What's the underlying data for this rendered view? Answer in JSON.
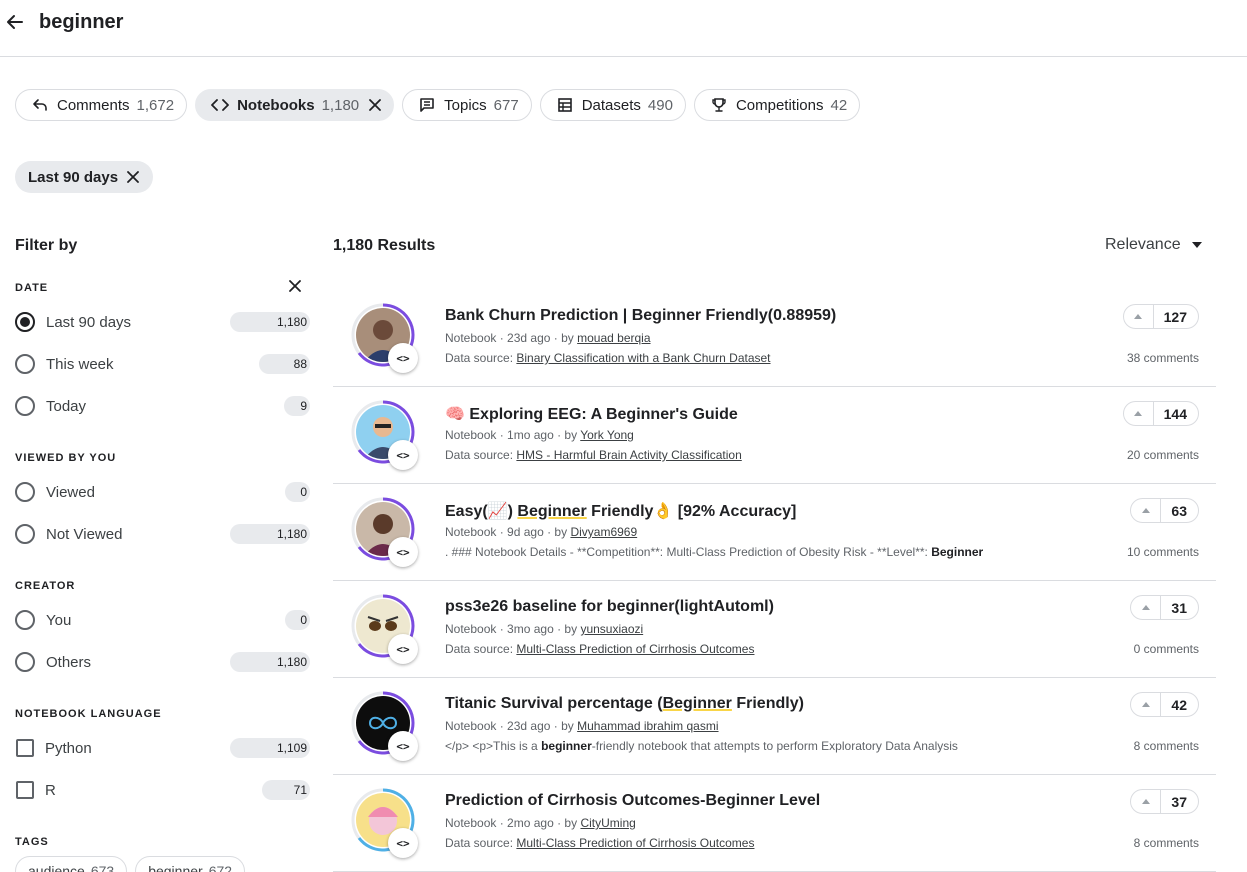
{
  "search": {
    "query": "beginner"
  },
  "type_chips": [
    {
      "icon": "reply-icon",
      "label": "Comments",
      "count": "1,672"
    },
    {
      "icon": "code-icon",
      "label": "Notebooks",
      "count": "1,180",
      "active": true
    },
    {
      "icon": "topics-icon",
      "label": "Topics",
      "count": "677"
    },
    {
      "icon": "table-icon",
      "label": "Datasets",
      "count": "490"
    },
    {
      "icon": "trophy-icon",
      "label": "Competitions",
      "count": "42"
    }
  ],
  "active_filter": {
    "label": "Last 90 days"
  },
  "sidebar": {
    "title": "Filter by",
    "date": {
      "label": "DATE",
      "options": [
        {
          "label": "Last 90 days",
          "count": "1,180",
          "checked": true
        },
        {
          "label": "This week",
          "count": "88"
        },
        {
          "label": "Today",
          "count": "9"
        }
      ]
    },
    "viewed": {
      "label": "VIEWED BY YOU",
      "options": [
        {
          "label": "Viewed",
          "count": "0"
        },
        {
          "label": "Not Viewed",
          "count": "1,180"
        }
      ]
    },
    "creator": {
      "label": "CREATOR",
      "options": [
        {
          "label": "You",
          "count": "0"
        },
        {
          "label": "Others",
          "count": "1,180"
        }
      ]
    },
    "language": {
      "label": "NOTEBOOK LANGUAGE",
      "options": [
        {
          "label": "Python",
          "count": "1,109"
        },
        {
          "label": "R",
          "count": "71"
        }
      ]
    },
    "tags": {
      "label": "TAGS",
      "items": [
        {
          "label": "audience",
          "count": "673"
        },
        {
          "label": "beginner",
          "count": "672"
        }
      ]
    }
  },
  "results": {
    "count_label": "1,180 Results",
    "sort_label": "Relevance",
    "items": [
      {
        "title": "Bank Churn Prediction | Beginner Friendly(0.88959)",
        "type": "Notebook",
        "age": "23d ago",
        "by": "by",
        "author": "mouad berqia",
        "sub_prefix": "Data source:",
        "sub_link": "Binary Classification with a Bank Churn Dataset",
        "votes": "127",
        "comments": "38 comments",
        "ring_color": "#7b4ce0",
        "avatar_color": "#2c3e6b"
      },
      {
        "title_pre": "🧠 Exploring EEG: A Beginner's Guide",
        "type": "Notebook",
        "age": "1mo ago",
        "by": "by",
        "author": "York Yong",
        "sub_prefix": "Data source:",
        "sub_link": "HMS - Harmful Brain Activity Classification",
        "votes": "144",
        "comments": "20 comments",
        "ring_color": "#7b4ce0",
        "avatar_color": "#4aa3d8"
      },
      {
        "title_a": "Easy(📈) ",
        "title_b": "Beginner",
        "title_c": " Friendly👌 [92% Accuracy]",
        "type": "Notebook",
        "age": "9d ago",
        "by": "by",
        "author": "Divyam6969",
        "snippet_a": ". ### Notebook Details - **Competition**: Multi-Class Prediction of Obesity Risk - **Level**: ",
        "snippet_b": "Beginner",
        "votes": "63",
        "comments": "10 comments",
        "ring_color": "#7b4ce0",
        "avatar_color": "#6b4a5a"
      },
      {
        "title": "pss3e26 baseline for beginner(lightAutoml)",
        "type": "Notebook",
        "age": "3mo ago",
        "by": "by",
        "author": "yunsuxiaozi",
        "sub_prefix": "Data source:",
        "sub_link": "Multi-Class Prediction of Cirrhosis Outcomes",
        "votes": "31",
        "comments": "0 comments",
        "ring_color": "#7b4ce0",
        "avatar_color": "#e8e2cc"
      },
      {
        "title_a": "Titanic Survival percentage (",
        "title_b": "Beginner",
        "title_c": " Friendly)",
        "type": "Notebook",
        "age": "23d ago",
        "by": "by",
        "author": "Muhammad ibrahim qasmi",
        "snippet_a": "</p> <p>This is a ",
        "snippet_b": "beginner",
        "snippet_c": "-friendly notebook that attempts to perform Exploratory Data Analysis",
        "votes": "42",
        "comments": "8 comments",
        "ring_color": "#7b4ce0",
        "avatar_color": "#0d0d0d"
      },
      {
        "title": "Prediction of Cirrhosis Outcomes-Beginner Level",
        "type": "Notebook",
        "age": "2mo ago",
        "by": "by",
        "author": "CityUming",
        "sub_prefix": "Data source:",
        "sub_link": "Multi-Class Prediction of Cirrhosis Outcomes",
        "votes": "37",
        "comments": "8 comments",
        "ring_color": "#4fb0e6",
        "avatar_color": "#f3c6d8"
      }
    ]
  }
}
